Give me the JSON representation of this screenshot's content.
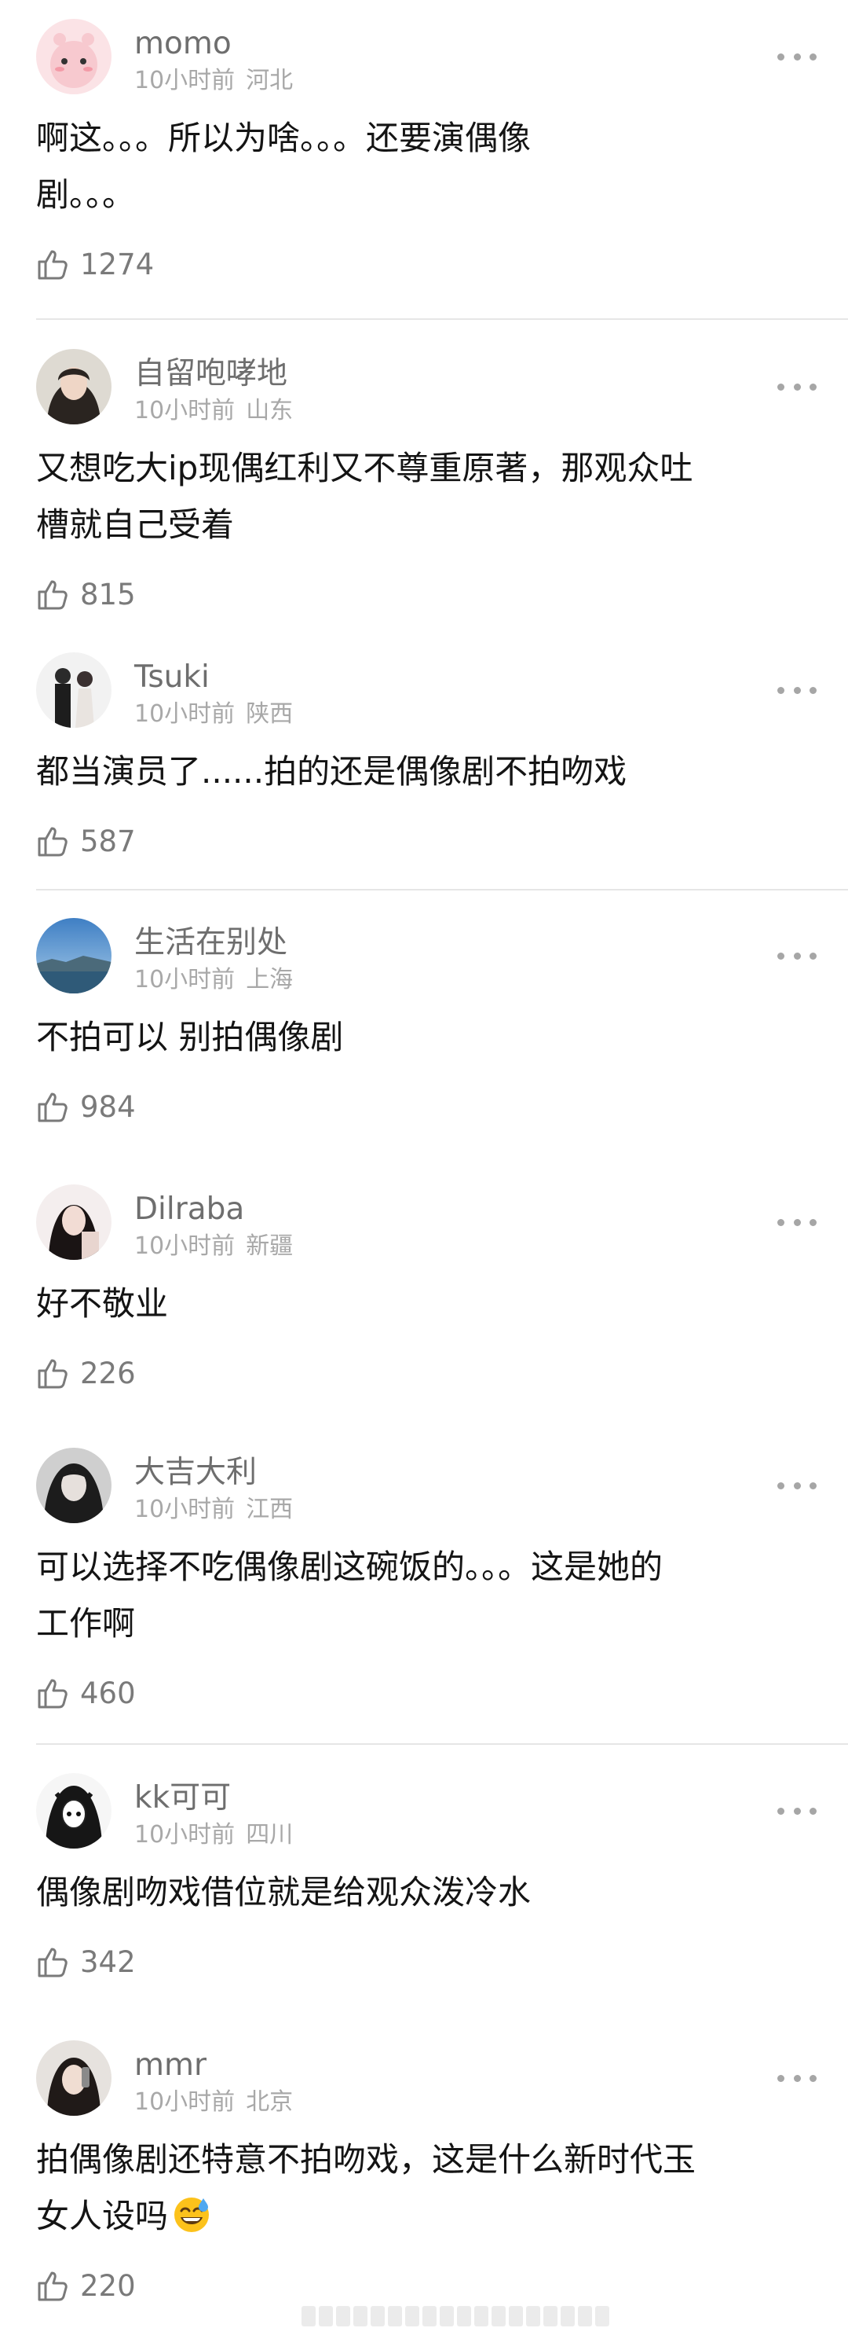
{
  "comments": [
    {
      "username": "momo",
      "time": "10小时前",
      "location": "河北",
      "text": "啊这。。。所以为啥。。。还要演偶像\n剧。。。",
      "likes": "1274"
    },
    {
      "username": "自留咆哮地",
      "time": "10小时前",
      "location": "山东",
      "text": "又想吃大ip现偶红利又不尊重原著，那观众吐\n槽就自己受着",
      "likes": "815"
    },
    {
      "username": "Tsuki",
      "time": "10小时前",
      "location": "陕西",
      "text": "都当演员了......拍的还是偶像剧不拍吻戏",
      "likes": "587"
    },
    {
      "username": "生活在别处",
      "time": "10小时前",
      "location": "上海",
      "text": "不拍可以 别拍偶像剧",
      "likes": "984"
    },
    {
      "username": "Dilraba",
      "time": "10小时前",
      "location": "新疆",
      "text": "好不敬业",
      "likes": "226"
    },
    {
      "username": "大吉大利",
      "time": "10小时前",
      "location": "江西",
      "text": "可以选择不吃偶像剧这碗饭的。。。这是她的\n工作啊",
      "likes": "460"
    },
    {
      "username": "kk可可",
      "time": "10小时前",
      "location": "四川",
      "text": "偶像剧吻戏借位就是给观众泼冷水",
      "likes": "342"
    },
    {
      "username": "mmr",
      "time": "10小时前",
      "location": "北京",
      "text": "拍偶像剧还特意不拍吻戏，这是什么新时代玉\n女人设吗",
      "likes": "220"
    }
  ],
  "icons": {
    "like": "thumbs-up-icon",
    "more": "more-dots-icon",
    "emoji": "sweat-smile-emoji"
  },
  "colors": {
    "username": "#6e6e6e",
    "meta": "#a8a8a8",
    "text": "#141414",
    "likes": "#7a7a7a",
    "divider": "#e6e6e6"
  }
}
